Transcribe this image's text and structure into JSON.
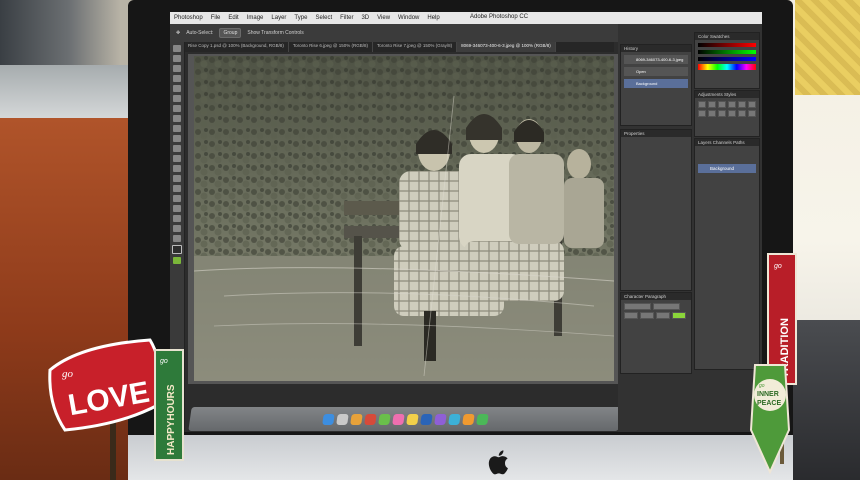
{
  "photoshop": {
    "menu": [
      "Photoshop",
      "File",
      "Edit",
      "Image",
      "Layer",
      "Type",
      "Select",
      "Filter",
      "3D",
      "View",
      "Window",
      "Help"
    ],
    "app_title": "Adobe Photoshop CC",
    "options": {
      "auto_select_label": "Auto-Select:",
      "auto_select_value": "Group",
      "show_transform_label": "Show Transform Controls"
    },
    "tabs": [
      {
        "label": "Rise Copy 1.psd @ 100% (Background, RGB/8)",
        "active": false
      },
      {
        "label": "Toronto Rise 6.jpeg @ 150% (RGB/8)",
        "active": false
      },
      {
        "label": "Toronto Rise 7.jpeg @ 150% (Gray/8)",
        "active": false
      },
      {
        "label": "8069-346073-400-6-3.jpeg @ 100% (RGB/8)",
        "active": true
      }
    ],
    "panels": {
      "history": "History",
      "properties": "Properties",
      "color": "Color",
      "swatches": "Swatches",
      "adjustments": "Adjustments",
      "styles": "Styles",
      "layers": "Layers",
      "channels": "Channels",
      "paths": "Paths",
      "character": "Character",
      "paragraph": "Paragraph",
      "layer_name": "Background",
      "history_items": [
        "8069-346073-400-6-3.jpeg",
        "Open",
        "Background"
      ]
    }
  },
  "signs": {
    "love_small": "go",
    "love": "LOVE",
    "happy_small": "go",
    "happy": "HAPPYHOURS",
    "tradition_small": "go",
    "tradition": "TRADITION",
    "peace_small": "go",
    "peace_line1": "INNER",
    "peace_line2": "PEACE"
  },
  "colors": {
    "photoshop_bg": "#2c2c2c",
    "green_accent": "#8bd63a",
    "love_red": "#c8202a",
    "tradition_red": "#b81e28"
  }
}
